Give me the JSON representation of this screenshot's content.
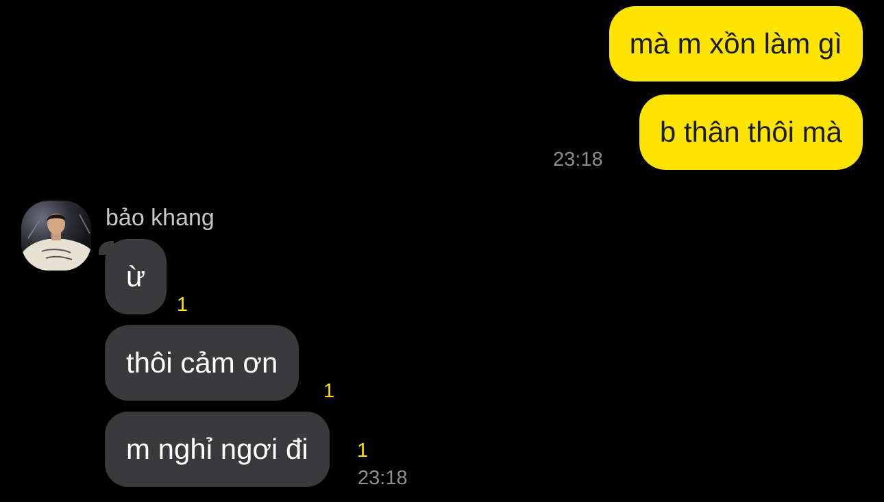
{
  "chat": {
    "outgoing": [
      {
        "text": "mà m xồn làm gì"
      },
      {
        "text": "b thân thôi mà"
      }
    ],
    "outgoing_time": "23:18",
    "incoming_sender": "bảo khang",
    "incoming": [
      {
        "text": "ừ",
        "unread": "1"
      },
      {
        "text": "thôi cảm ơn",
        "unread": "1"
      },
      {
        "text": "m nghỉ ngơi đi",
        "unread": "1"
      }
    ],
    "incoming_time": "23:18"
  },
  "colors": {
    "background": "#000000",
    "sent_bubble": "#FEE500",
    "received_bubble": "#3A3A3C",
    "unread_count": "#FEE500",
    "timestamp": "#8E8E93"
  },
  "icons": {
    "avatar": "profile-photo"
  }
}
